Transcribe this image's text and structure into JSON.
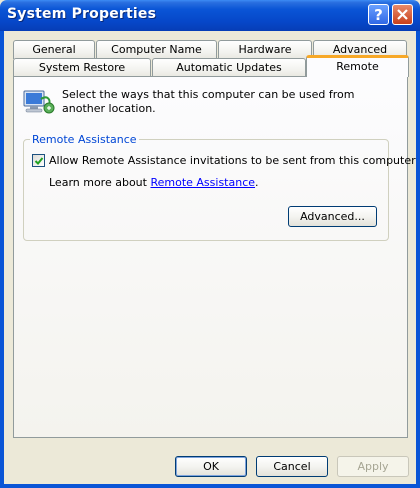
{
  "window": {
    "title": "System Properties",
    "help_button": "?",
    "close_button": "✕"
  },
  "tabs": {
    "row1": [
      "General",
      "Computer Name",
      "Hardware",
      "Advanced"
    ],
    "row2": [
      "System Restore",
      "Automatic Updates",
      "Remote"
    ],
    "active": "Remote"
  },
  "remote": {
    "intro": "Select the ways that this computer can be used from another location.",
    "icon": "remote-computer-icon",
    "group_title": "Remote Assistance",
    "allow_label": "Allow Remote Assistance invitations to be sent from this computer",
    "allow_checked": true,
    "learn_prefix": "Learn more about ",
    "learn_link": "Remote Assistance",
    "learn_suffix": ".",
    "advanced_button": "Advanced..."
  },
  "footer": {
    "ok": "OK",
    "cancel": "Cancel",
    "apply": "Apply"
  },
  "colors": {
    "titlebar": "#0a55d6",
    "tab_highlight": "#f7a827",
    "group_title": "#0046d5",
    "link": "#0000ff"
  }
}
